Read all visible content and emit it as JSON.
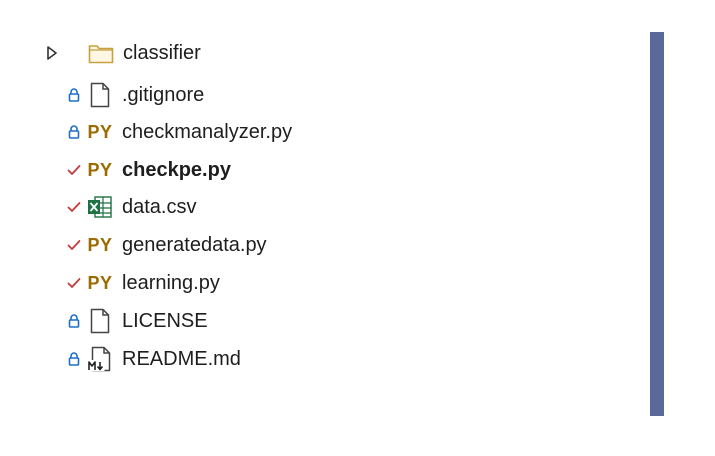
{
  "explorer": {
    "items": [
      {
        "name": "classifier",
        "kind": "folder",
        "status": "none",
        "expanded": false,
        "bold": false,
        "icon": "folder-icon",
        "expander_icon": "collapsed-triangle-icon"
      },
      {
        "name": ".gitignore",
        "kind": "file",
        "status": "locked",
        "bold": false,
        "icon": "document-icon",
        "status_icon": "lock-icon"
      },
      {
        "name": "checkmanalyzer.py",
        "kind": "python",
        "icon_text": "PY",
        "status": "locked",
        "bold": false,
        "icon": "python-icon",
        "status_icon": "lock-icon"
      },
      {
        "name": "checkpe.py",
        "kind": "python",
        "icon_text": "PY",
        "status": "checked-out",
        "bold": true,
        "icon": "python-icon",
        "status_icon": "checkmark-icon"
      },
      {
        "name": "data.csv",
        "kind": "csv",
        "status": "checked-out",
        "bold": false,
        "icon": "excel-icon",
        "status_icon": "checkmark-icon"
      },
      {
        "name": "generatedata.py",
        "kind": "python",
        "icon_text": "PY",
        "status": "checked-out",
        "bold": false,
        "icon": "python-icon",
        "status_icon": "checkmark-icon"
      },
      {
        "name": "learning.py",
        "kind": "python",
        "icon_text": "PY",
        "status": "checked-out",
        "bold": false,
        "icon": "python-icon",
        "status_icon": "checkmark-icon"
      },
      {
        "name": "LICENSE",
        "kind": "file",
        "status": "locked",
        "bold": false,
        "icon": "document-icon",
        "status_icon": "lock-icon"
      },
      {
        "name": "README.md",
        "kind": "markdown",
        "status": "locked",
        "bold": false,
        "icon": "markdown-icon",
        "status_icon": "lock-icon"
      }
    ]
  },
  "colors": {
    "lock": "#1e6fc8",
    "check": "#c53b3b",
    "python_label": "#9b6b00",
    "folder": "#c8a040",
    "excel": "#1e7145",
    "scroll_edge": "#5b6999"
  }
}
